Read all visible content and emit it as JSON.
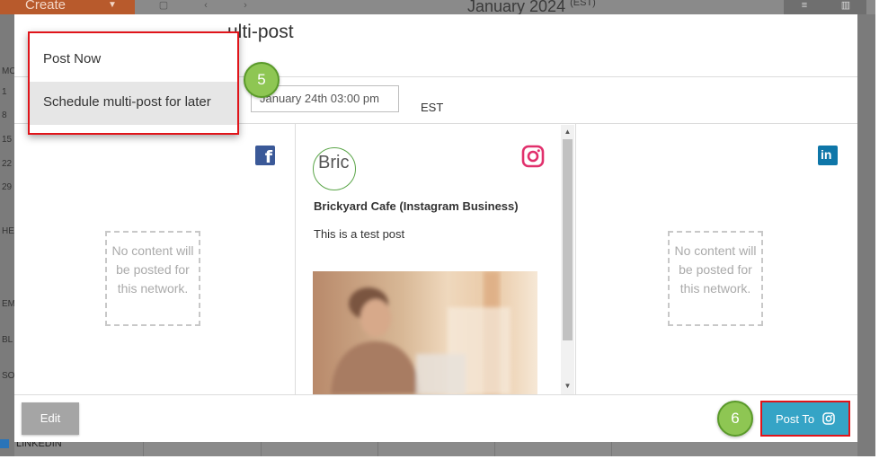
{
  "background": {
    "create_label": "Create",
    "month_label": "January 2024",
    "timezone_tag": "(EST)",
    "left_rail": [
      "MO",
      "1",
      "8",
      "15",
      "22",
      "29",
      "HE",
      "EM",
      "BL",
      "SO"
    ],
    "linkedin_label": "LINKEDIN"
  },
  "modal": {
    "title_partial": "ulti-post",
    "dropdown": {
      "items": [
        "Post Now",
        "Schedule multi-post for later"
      ],
      "selected": "Schedule multi-post for later"
    },
    "schedule": {
      "date_value": "January 24th 03:00 pm",
      "timezone": "EST"
    },
    "callouts": {
      "step5": "5",
      "step6": "6"
    },
    "columns": {
      "facebook": {
        "icon": "facebook-icon",
        "empty_text": "No content will be posted for this network."
      },
      "instagram": {
        "icon": "instagram-icon",
        "avatar_alt": "Bric",
        "profile_name": "Brickyard Cafe (Instagram Business)",
        "post_text": "This is a test post"
      },
      "linkedin": {
        "icon": "linkedin-icon",
        "empty_text": "No content will be posted for this network."
      }
    },
    "footer": {
      "edit_label": "Edit",
      "post_to_label": "Post To"
    }
  },
  "colors": {
    "accent_red": "#e0141a",
    "badge_green": "#8ec653",
    "post_button": "#35a4c6",
    "facebook": "#3b5998",
    "instagram": "#e1306c",
    "linkedin": "#0e76a8"
  }
}
